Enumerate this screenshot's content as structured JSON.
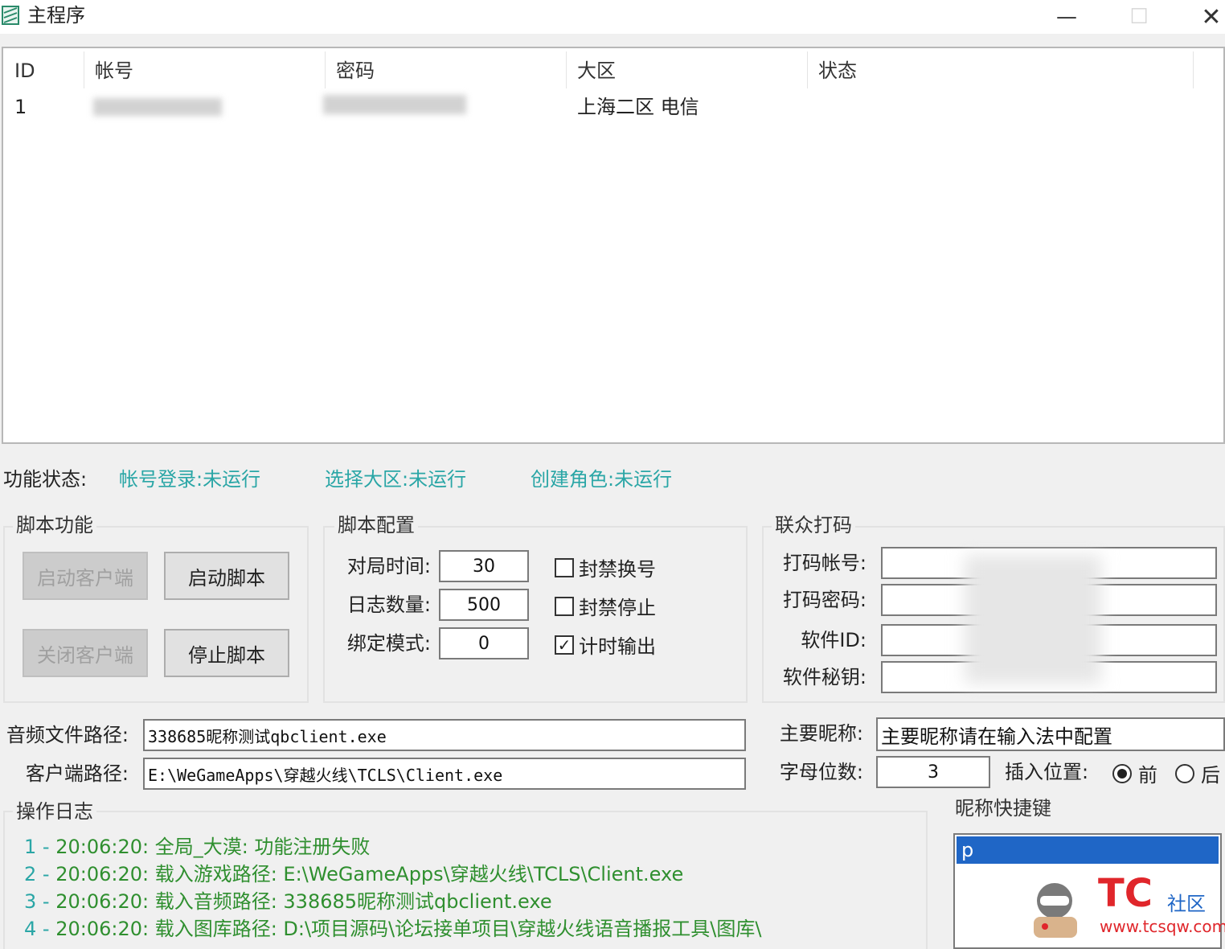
{
  "window": {
    "title": "主程序",
    "minimize": "—",
    "maximize": "☐",
    "close": "✕"
  },
  "list": {
    "columns": [
      "ID",
      "帐号",
      "密码",
      "大区",
      "状态"
    ],
    "rows": [
      {
        "id": "1",
        "region": "上海二区 电信"
      }
    ]
  },
  "status": {
    "label": "功能状态:",
    "items": [
      "帐号登录:未运行",
      "选择大区:未运行",
      "创建角色:未运行"
    ]
  },
  "script_functions": {
    "title": "脚本功能",
    "start_client": "启动客户端",
    "start_script": "启动脚本",
    "close_client": "关闭客户端",
    "stop_script": "停止脚本"
  },
  "script_config": {
    "title": "脚本配置",
    "match_time_label": "对局时间:",
    "match_time_value": "30",
    "log_count_label": "日志数量:",
    "log_count_value": "500",
    "bind_mode_label": "绑定模式:",
    "bind_mode_value": "0",
    "ban_switch_label": "封禁换号",
    "ban_switch_checked": false,
    "ban_stop_label": "封禁停止",
    "ban_stop_checked": false,
    "timer_output_label": "计时输出",
    "timer_output_checked": true
  },
  "captcha": {
    "title": "联众打码",
    "account_label": "打码帐号:",
    "password_label": "打码密码:",
    "software_id_label": "软件ID:",
    "software_key_label": "软件秘钥:"
  },
  "paths": {
    "audio_label": "音频文件路径:",
    "audio_value": "338685昵称测试qbclient.exe",
    "client_label": "客户端路径:",
    "client_value": "E:\\WeGameApps\\穿越火线\\TCLS\\Client.exe"
  },
  "nickname": {
    "main_label": "主要昵称:",
    "main_value": "主要昵称请在输入法中配置",
    "letter_count_label": "字母位数:",
    "letter_count_value": "3",
    "insert_pos_label": "插入位置:",
    "insert_before": "前",
    "insert_after": "后",
    "selected": "前"
  },
  "log": {
    "title": "操作日志",
    "lines": [
      {
        "num": "1 - ",
        "text": "20:06:20:  全局_大漠:  功能注册失败"
      },
      {
        "num": "2 - ",
        "text": "20:06:20:  载入游戏路径:  E:\\WeGameApps\\穿越火线\\TCLS\\Client.exe"
      },
      {
        "num": "3 - ",
        "text": "20:06:20:  载入音频路径:  338685昵称测试qbclient.exe"
      },
      {
        "num": "4 - ",
        "text": "20:06:20:  载入图库路径:  D:\\项目源码\\论坛接单项目\\穿越火线语音播报工具\\图库\\"
      }
    ]
  },
  "shortcut": {
    "title": "昵称快捷键",
    "items": [
      "p"
    ]
  },
  "watermark": {
    "logo": "TC",
    "label": "社区",
    "url": "www.tcsqw.com"
  },
  "colors": {
    "status_text": "#2aa6a6",
    "log_text": "#2f8f2f",
    "selection": "#1f66c6",
    "watermark": "#e0262b"
  }
}
